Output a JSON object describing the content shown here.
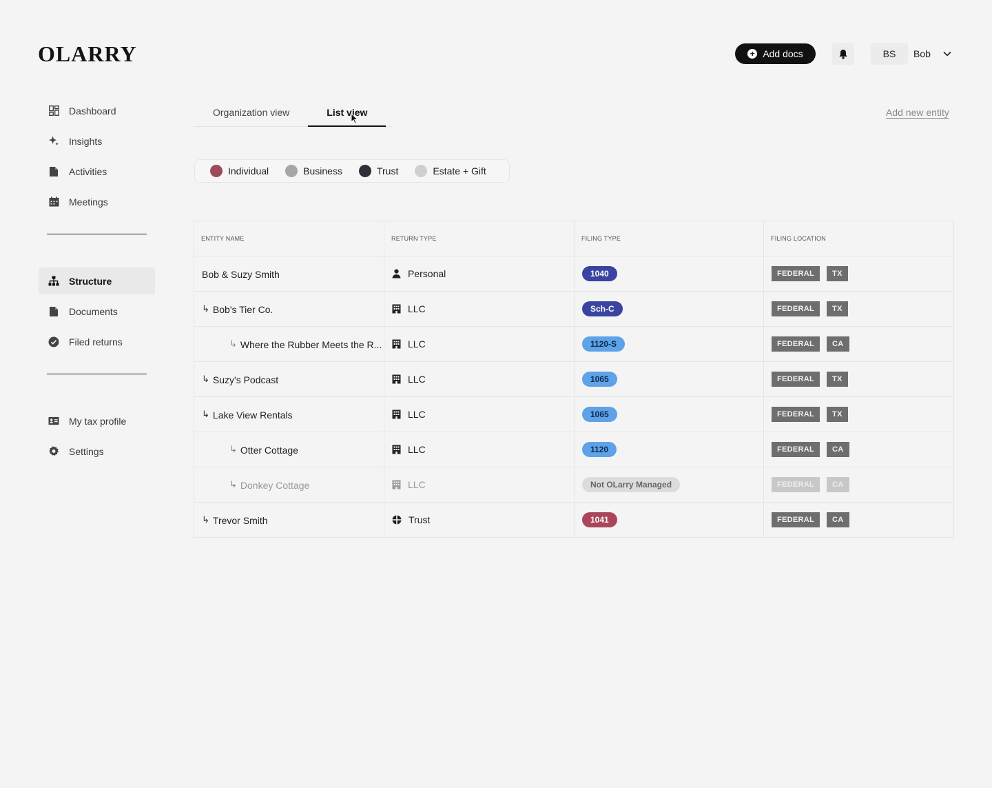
{
  "header": {
    "logo": "OLARRY",
    "add_docs_label": "Add docs",
    "user_initials": "BS",
    "user_name": "Bob"
  },
  "sidebar": {
    "group1": [
      {
        "label": "Dashboard",
        "icon": "dashboard-icon"
      },
      {
        "label": "Insights",
        "icon": "sparkle-icon"
      },
      {
        "label": "Activities",
        "icon": "file-icon"
      },
      {
        "label": "Meetings",
        "icon": "calendar-icon"
      }
    ],
    "group2": [
      {
        "label": "Structure",
        "icon": "hierarchy-icon",
        "active": true
      },
      {
        "label": "Documents",
        "icon": "document-icon"
      },
      {
        "label": "Filed returns",
        "icon": "check-circle-icon"
      }
    ],
    "group3": [
      {
        "label": "My tax profile",
        "icon": "id-card-icon"
      },
      {
        "label": "Settings",
        "icon": "gear-icon"
      }
    ]
  },
  "tabs": [
    "Organization view",
    "List view"
  ],
  "active_tab": "List view",
  "add_new_entity_label": "Add new entity",
  "legend": [
    {
      "label": "Individual",
      "color": "#9e4a5c"
    },
    {
      "label": "Business",
      "color": "#a6a6a6"
    },
    {
      "label": "Trust",
      "color": "#2f2f3a"
    },
    {
      "label": "Estate + Gift",
      "color": "#cfcfcf"
    }
  ],
  "table": {
    "headers": [
      "ENTITY NAME",
      "RETURN TYPE",
      "FILING TYPE",
      "FILING LOCATION"
    ],
    "rows": [
      {
        "name": "Bob & Suzy Smith",
        "level": 0,
        "return_type": "Personal",
        "return_icon": "person-icon",
        "filing": "1040",
        "filing_color": "#3a43a0",
        "locations": [
          "FEDERAL",
          "TX"
        ],
        "dim": false
      },
      {
        "name": "Bob's Tier Co.",
        "level": 1,
        "return_type": "LLC",
        "return_icon": "building-icon",
        "filing": "Sch-C",
        "filing_color": "#3a43a0",
        "locations": [
          "FEDERAL",
          "TX"
        ],
        "dim": false
      },
      {
        "name": "Where the Rubber Meets the R...",
        "level": 2,
        "return_type": "LLC",
        "return_icon": "building-icon",
        "filing": "1120-S",
        "filing_color": "#5ea2e8",
        "locations": [
          "FEDERAL",
          "CA"
        ],
        "dim": false
      },
      {
        "name": "Suzy's Podcast",
        "level": 1,
        "return_type": "LLC",
        "return_icon": "building-icon",
        "filing": "1065",
        "filing_color": "#5ea2e8",
        "locations": [
          "FEDERAL",
          "TX"
        ],
        "dim": false
      },
      {
        "name": "Lake View Rentals",
        "level": 1,
        "return_type": "LLC",
        "return_icon": "building-icon",
        "filing": "1065",
        "filing_color": "#5ea2e8",
        "locations": [
          "FEDERAL",
          "TX"
        ],
        "dim": false
      },
      {
        "name": "Otter Cottage",
        "level": 2,
        "return_type": "LLC",
        "return_icon": "building-icon",
        "filing": "1120",
        "filing_color": "#5ea2e8",
        "locations": [
          "FEDERAL",
          "CA"
        ],
        "dim": false
      },
      {
        "name": "Donkey Cottage",
        "level": 2,
        "return_type": "LLC",
        "return_icon": "building-icon",
        "filing": "Not OLarry Managed",
        "filing_color": "#dcdcdc",
        "locations": [
          "FEDERAL",
          "CA"
        ],
        "dim": true
      },
      {
        "name": "Trevor Smith",
        "level": 1,
        "return_type": "Trust",
        "return_icon": "trust-icon",
        "filing": "1041",
        "filing_color": "#a9465a",
        "locations": [
          "FEDERAL",
          "CA"
        ],
        "dim": false
      }
    ]
  }
}
